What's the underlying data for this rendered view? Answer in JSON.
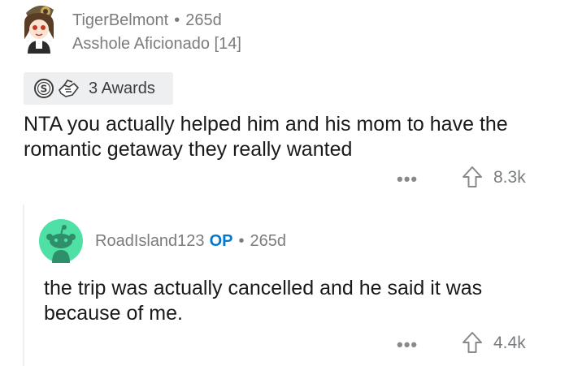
{
  "comment": {
    "username": "TigerBelmont",
    "separator": "•",
    "age": "265d",
    "flair": "Asshole Aficionado [14]",
    "awards_label": "3 Awards",
    "body": "NTA you actually helped him and his mom to have the romantic getaway they really wanted",
    "more_label": "•••",
    "score": "8.3k"
  },
  "reply": {
    "username": "RoadIsland123",
    "op_badge": "OP",
    "separator": "•",
    "age": "265d",
    "body": "the trip was actually cancelled and he said it was because of me.",
    "more_label": "•••",
    "score": "4.4k"
  },
  "colors": {
    "meta_gray": "#7c7c7c",
    "op_blue": "#0079d3",
    "awards_bg": "#edeff1",
    "reply_avatar_bg": "#4fe0a6"
  },
  "icons": [
    "user-avatar",
    "silver-award-icon",
    "helpful-award-icon",
    "upvote-arrow-icon",
    "snoo-avatar"
  ]
}
